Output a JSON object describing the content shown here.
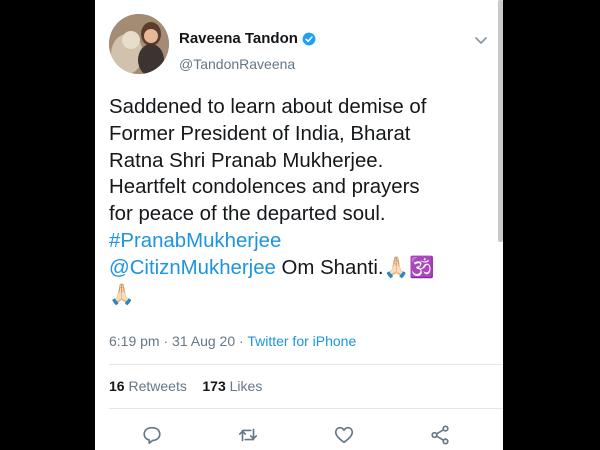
{
  "user": {
    "display_name": "Raveena Tandon",
    "handle": "@TandonRaveena",
    "verified_icon": "verified-badge-icon"
  },
  "tweet": {
    "text": "Saddened to learn about demise of\nFormer President of India, Bharat\nRatna Shri Pranab Mukherjee.\nHeartfelt condolences and prayers\nfor peace of the departed soul.",
    "hashtag": "#PranabMukherjee",
    "mention": "@CitiznMukherjee",
    "after_mention": " Om Shanti.",
    "emoji_line1": "🙏🏻🕉️",
    "emoji_line2": "🙏🏻"
  },
  "meta": {
    "time": "6:19 pm",
    "date": "31 Aug 20",
    "source": "Twitter for iPhone",
    "separator": " · "
  },
  "stats": {
    "retweets_count": "16",
    "retweets_label": "Retweets",
    "likes_count": "173",
    "likes_label": "Likes"
  },
  "actions": [
    "reply-icon",
    "retweet-icon",
    "like-icon",
    "share-icon"
  ],
  "colors": {
    "link": "#1b95e0",
    "verified": "#1da1f2",
    "text": "#14171a",
    "muted": "#657786"
  }
}
